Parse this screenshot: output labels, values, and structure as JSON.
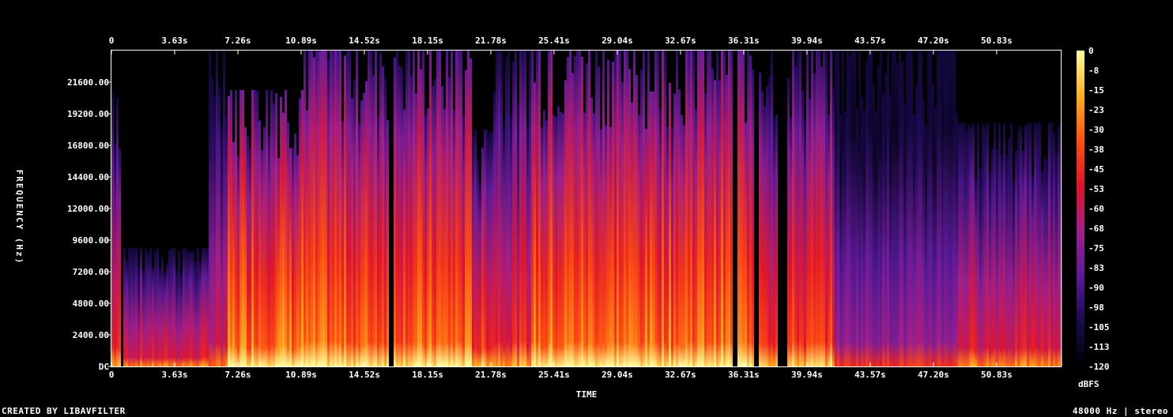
{
  "chart_data": {
    "type": "heatmap",
    "title": "",
    "xlabel": "TIME",
    "ylabel": "FREQUENCY (Hz)",
    "x_ticks": [
      "0",
      "3.63s",
      "7.26s",
      "10.89s",
      "14.52s",
      "18.15s",
      "21.78s",
      "25.41s",
      "29.04s",
      "32.67s",
      "36.31s",
      "39.94s",
      "43.57s",
      "47.20s",
      "50.83s"
    ],
    "x_tick_step_s": 3.63,
    "y_ticks": [
      "DC",
      "2400.00",
      "4800.00",
      "7200.00",
      "9600.00",
      "12000.00",
      "14400.00",
      "16800.00",
      "19200.00",
      "21600.00"
    ],
    "y_tick_step_hz": 2400,
    "ylim": [
      0,
      24000
    ],
    "xlim": [
      0,
      54.5
    ],
    "colorbar": {
      "label": "dBFS",
      "ticks": [
        "0",
        "-8",
        "-15",
        "-23",
        "-30",
        "-38",
        "-45",
        "-53",
        "-60",
        "-68",
        "-75",
        "-83",
        "-90",
        "-98",
        "-105",
        "-113",
        "-120"
      ],
      "range": [
        -120,
        0
      ],
      "colormap": [
        "#000000",
        "#1a0a50",
        "#5a1a9a",
        "#a0208a",
        "#e0142a",
        "#ff5010",
        "#ffb020",
        "#ffffa0"
      ]
    },
    "segments": [
      {
        "t0": 0.0,
        "t1": 0.5,
        "max_hz": 21000,
        "level": 0.55
      },
      {
        "t0": 0.5,
        "t1": 5.5,
        "max_hz": 9000,
        "level": 0.5
      },
      {
        "t0": 5.5,
        "t1": 6.6,
        "max_hz": 24000,
        "level": 0.45
      },
      {
        "t0": 6.6,
        "t1": 11.0,
        "max_hz": 21000,
        "level": 0.72
      },
      {
        "t0": 11.0,
        "t1": 20.6,
        "max_hz": 24000,
        "level": 0.68
      },
      {
        "t0": 20.6,
        "t1": 21.8,
        "max_hz": 18000,
        "level": 0.6
      },
      {
        "t0": 21.8,
        "t1": 24.0,
        "max_hz": 24000,
        "level": 0.55
      },
      {
        "t0": 24.0,
        "t1": 37.5,
        "max_hz": 24000,
        "level": 0.7
      },
      {
        "t0": 37.5,
        "t1": 41.5,
        "max_hz": 24000,
        "level": 0.6
      },
      {
        "t0": 41.5,
        "t1": 48.5,
        "max_hz": 24000,
        "level": 0.35
      },
      {
        "t0": 48.5,
        "t1": 54.5,
        "max_hz": 18500,
        "level": 0.5
      }
    ],
    "dark_gaps_s": [
      0.55,
      16.0,
      35.7,
      37.0,
      38.3,
      38.6
    ]
  },
  "footer": {
    "left": "CREATED BY LIBAVFILTER",
    "right": "48000 Hz | stereo"
  }
}
